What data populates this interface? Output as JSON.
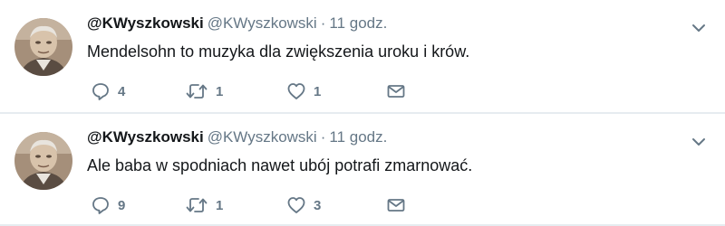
{
  "tweets": [
    {
      "display_name": "@KWyszkowski",
      "handle": "@KWyszkowski",
      "separator": "·",
      "time": "11 godz.",
      "text": "Mendelsohn to muzyka dla zwiększenia uroku i krów.",
      "reply_count": "4",
      "retweet_count": "1",
      "like_count": "1",
      "icons": {
        "reply": "reply-icon",
        "retweet": "retweet-icon",
        "like": "heart-icon",
        "dm": "envelope-icon",
        "menu": "chevron-down-icon"
      }
    },
    {
      "display_name": "@KWyszkowski",
      "handle": "@KWyszkowski",
      "separator": "·",
      "time": "11 godz.",
      "text": "Ale baba w spodniach nawet ubój potrafi zmarnować.",
      "reply_count": "9",
      "retweet_count": "1",
      "like_count": "3",
      "icons": {
        "reply": "reply-icon",
        "retweet": "retweet-icon",
        "like": "heart-icon",
        "dm": "envelope-icon",
        "menu": "chevron-down-icon"
      }
    }
  ],
  "colors": {
    "text_primary": "#14171a",
    "text_secondary": "#657786",
    "divider": "#e6ecf0",
    "background": "#ffffff"
  }
}
